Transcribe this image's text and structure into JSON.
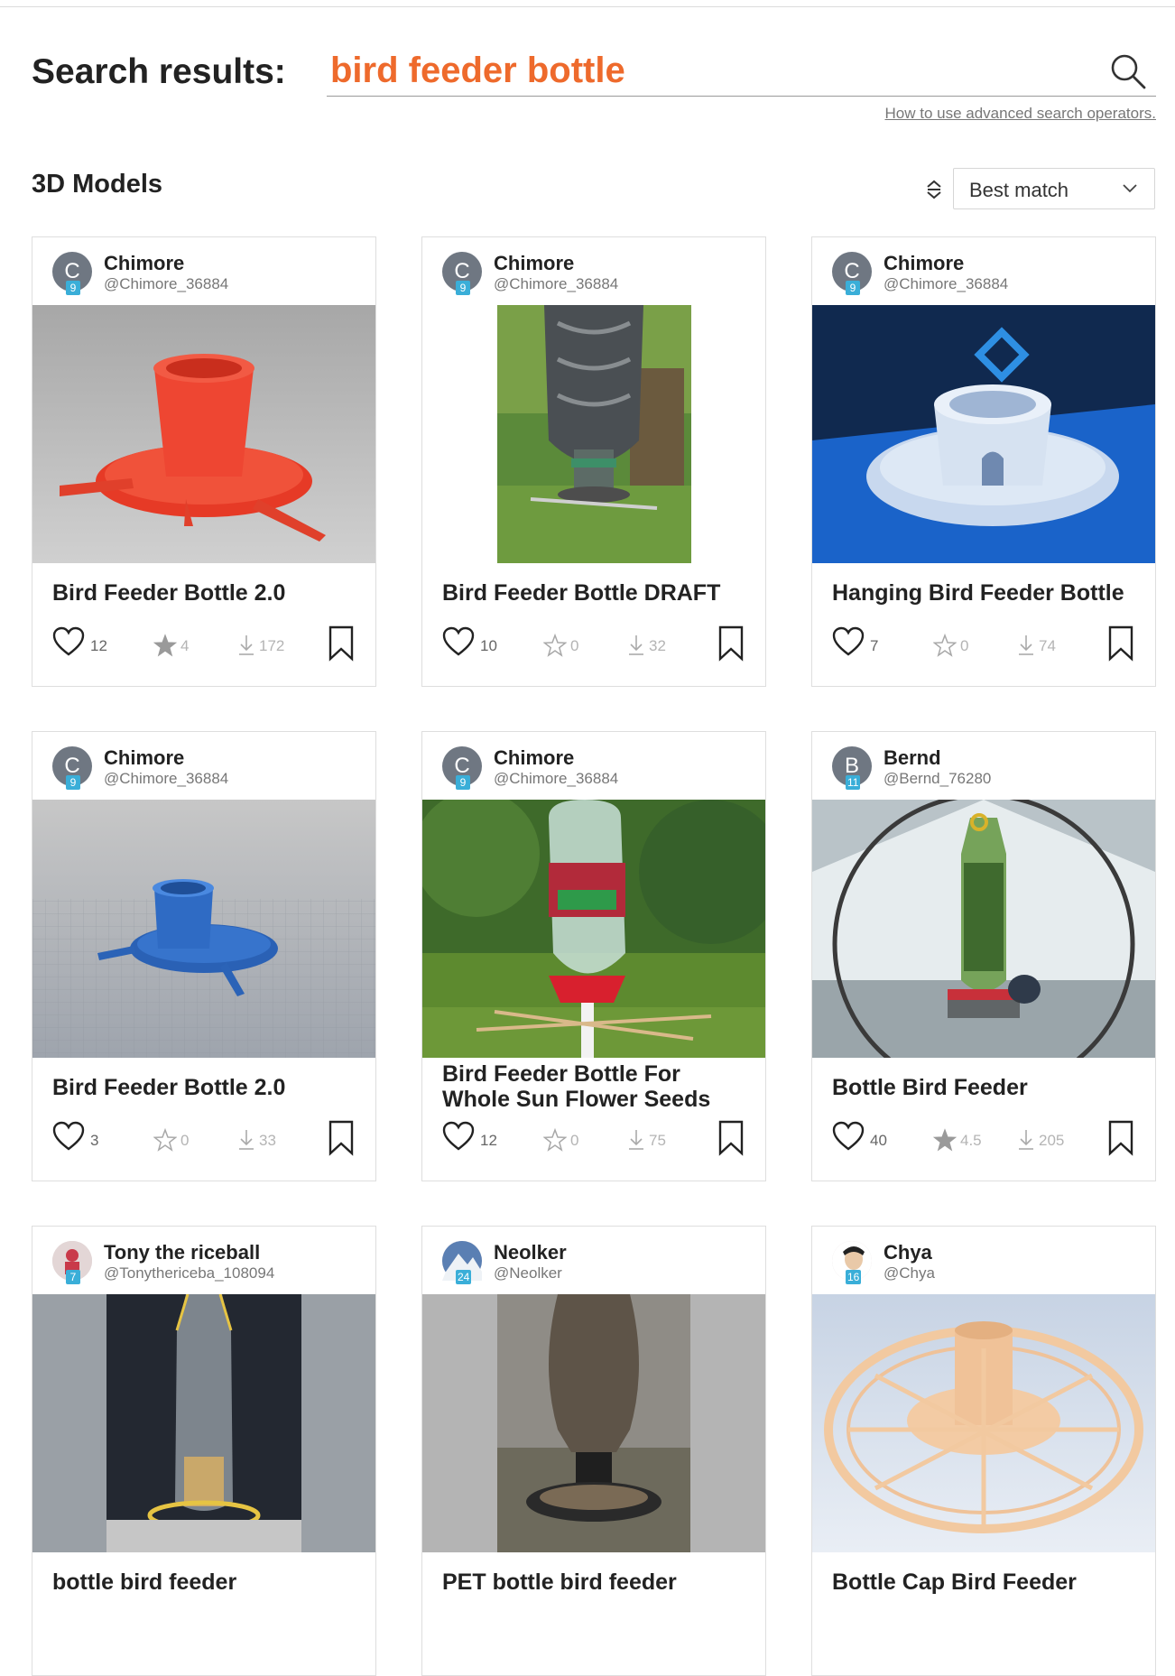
{
  "search": {
    "heading": "Search results:",
    "query": "bird feeder bottle",
    "advanced_link": "How to use advanced search operators."
  },
  "section": {
    "title": "3D Models",
    "sort_label": "Best match"
  },
  "colors": {
    "accent": "#ee6a2c",
    "badge": "#3aaed8",
    "avatar": "#6f7782"
  },
  "cards": [
    {
      "author": "Chimore",
      "handle": "@Chimore_36884",
      "initial": "C",
      "badge": "9",
      "title": "Bird Feeder Bottle 2.0",
      "likes": "12",
      "rating": "4",
      "downloads": "172",
      "rated": true,
      "image": "red-3d-render-feeder"
    },
    {
      "author": "Chimore",
      "handle": "@Chimore_36884",
      "initial": "C",
      "badge": "9",
      "title": "Bird Feeder Bottle DRAFT",
      "likes": "10",
      "rating": "0",
      "downloads": "32",
      "rated": false,
      "image": "photo-bottle-feeder-garden"
    },
    {
      "author": "Chimore",
      "handle": "@Chimore_36884",
      "initial": "C",
      "badge": "9",
      "title": "Hanging Bird Feeder Bottle",
      "likes": "7",
      "rating": "0",
      "downloads": "74",
      "rated": false,
      "image": "white-print-blue-bed"
    },
    {
      "author": "Chimore",
      "handle": "@Chimore_36884",
      "initial": "C",
      "badge": "9",
      "title": "Bird Feeder Bottle 2.0",
      "likes": "3",
      "rating": "0",
      "downloads": "33",
      "rated": false,
      "image": "blue-3d-render-feeder"
    },
    {
      "author": "Chimore",
      "handle": "@Chimore_36884",
      "initial": "C",
      "badge": "9",
      "title": "Bird Feeder Bottle For Whole Sun Flower Seeds",
      "likes": "12",
      "rating": "0",
      "downloads": "75",
      "rated": false,
      "image": "photo-juice-bottle-feeder"
    },
    {
      "author": "Bernd",
      "handle": "@Bernd_76280",
      "initial": "B",
      "badge": "11",
      "title": "Bottle Bird Feeder",
      "likes": "40",
      "rating": "4.5",
      "downloads": "205",
      "rated": true,
      "image": "photo-green-bottle-bird"
    },
    {
      "author": "Tony the riceball",
      "handle": "@Tonythericeba_108094",
      "initial": "",
      "badge": "7",
      "title": "bottle bird feeder",
      "likes": "",
      "rating": "",
      "downloads": "",
      "rated": false,
      "image": "photo-yellow-hanging-bottle"
    },
    {
      "author": "Neolker",
      "handle": "@Neolker",
      "initial": "",
      "badge": "24",
      "title": "PET bottle bird feeder",
      "likes": "",
      "rating": "",
      "downloads": "",
      "rated": false,
      "image": "photo-seed-bottle-tray"
    },
    {
      "author": "Chya",
      "handle": "@Chya",
      "initial": "",
      "badge": "16",
      "title": "Bottle Cap Bird Feeder",
      "likes": "",
      "rating": "",
      "downloads": "",
      "rated": false,
      "image": "peach-cad-render-tray"
    }
  ]
}
